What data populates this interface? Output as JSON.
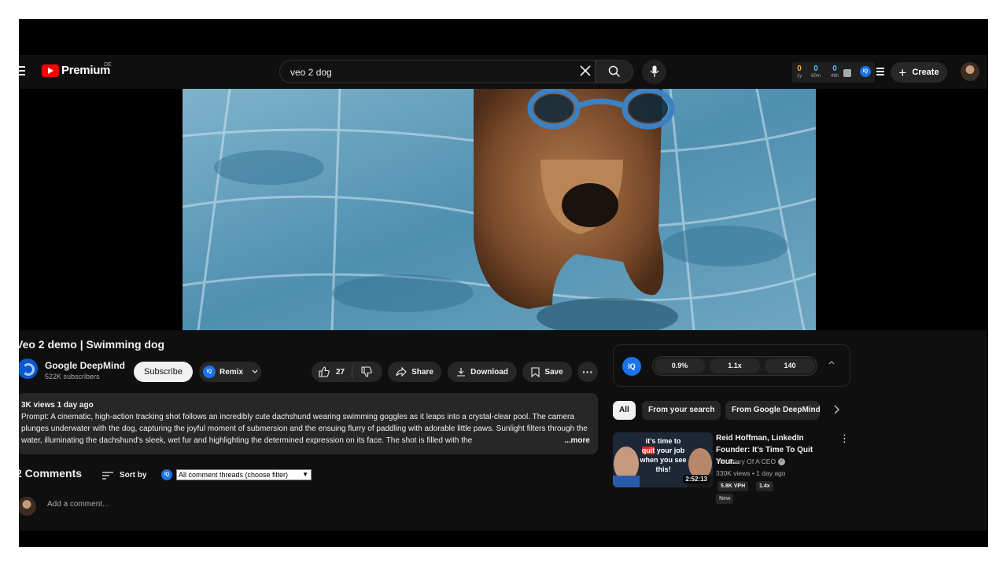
{
  "header": {
    "logo_text": "Premium",
    "region": "DE",
    "search_value": "veo 2 dog",
    "stats": [
      {
        "value": "0",
        "label": "1y",
        "color": "#f9a825"
      },
      {
        "value": "0",
        "label": "60m",
        "color": "#4fc3f7"
      },
      {
        "value": "0",
        "label": "48h",
        "color": "#4fc3f7"
      }
    ],
    "iq_label": "IQ",
    "create_label": "Create"
  },
  "video": {
    "title": "Veo 2 demo | Swimming dog",
    "channel": "Google DeepMind",
    "subscribers": "522K subscribers",
    "subscribe_label": "Subscribe",
    "remix_label": "Remix",
    "like_count": "27",
    "share_label": "Share",
    "download_label": "Download",
    "save_label": "Save",
    "more_label": "···"
  },
  "description": {
    "meta": "3K views  1 day ago",
    "text": "Prompt: A cinematic, high-action tracking shot follows an incredibly cute dachshund wearing swimming goggles as it leaps into a crystal-clear pool. The camera plunges underwater with the dog, capturing the joyful moment of submersion and the ensuing flurry of paddling with adorable little paws. Sunlight filters through the water, illuminating the dachshund's sleek, wet fur and highlighting the determined expression on its face. The shot is filled with the",
    "more": "...more"
  },
  "comments": {
    "heading": "2 Comments",
    "sort_label": "Sort by",
    "filter_value": "All comment threads (choose filter)",
    "add_placeholder": "Add a comment..."
  },
  "iq_panel": {
    "label": "IQ",
    "metrics": [
      "0.9%",
      "1.1x",
      "140"
    ]
  },
  "chips": [
    "All",
    "From your search",
    "From Google DeepMind"
  ],
  "recommendation": {
    "title": "Reid Hoffman, LinkedIn Founder: It’s Time To Quit Your...",
    "channel": "The Diary Of A CEO",
    "views": "330K views • 1 day ago",
    "duration": "2:52:13",
    "overlay_before": "it’s time to ",
    "overlay_highlight": "quit",
    "overlay_after": " your job when you see this!",
    "vph": "5.8K VPH",
    "multiplier": "1.4x",
    "badge": "New"
  },
  "colors": {
    "background": "#0f0f0f",
    "accent_red": "#ff0000",
    "iq_blue": "#1a73e8",
    "pill": "#272727"
  }
}
